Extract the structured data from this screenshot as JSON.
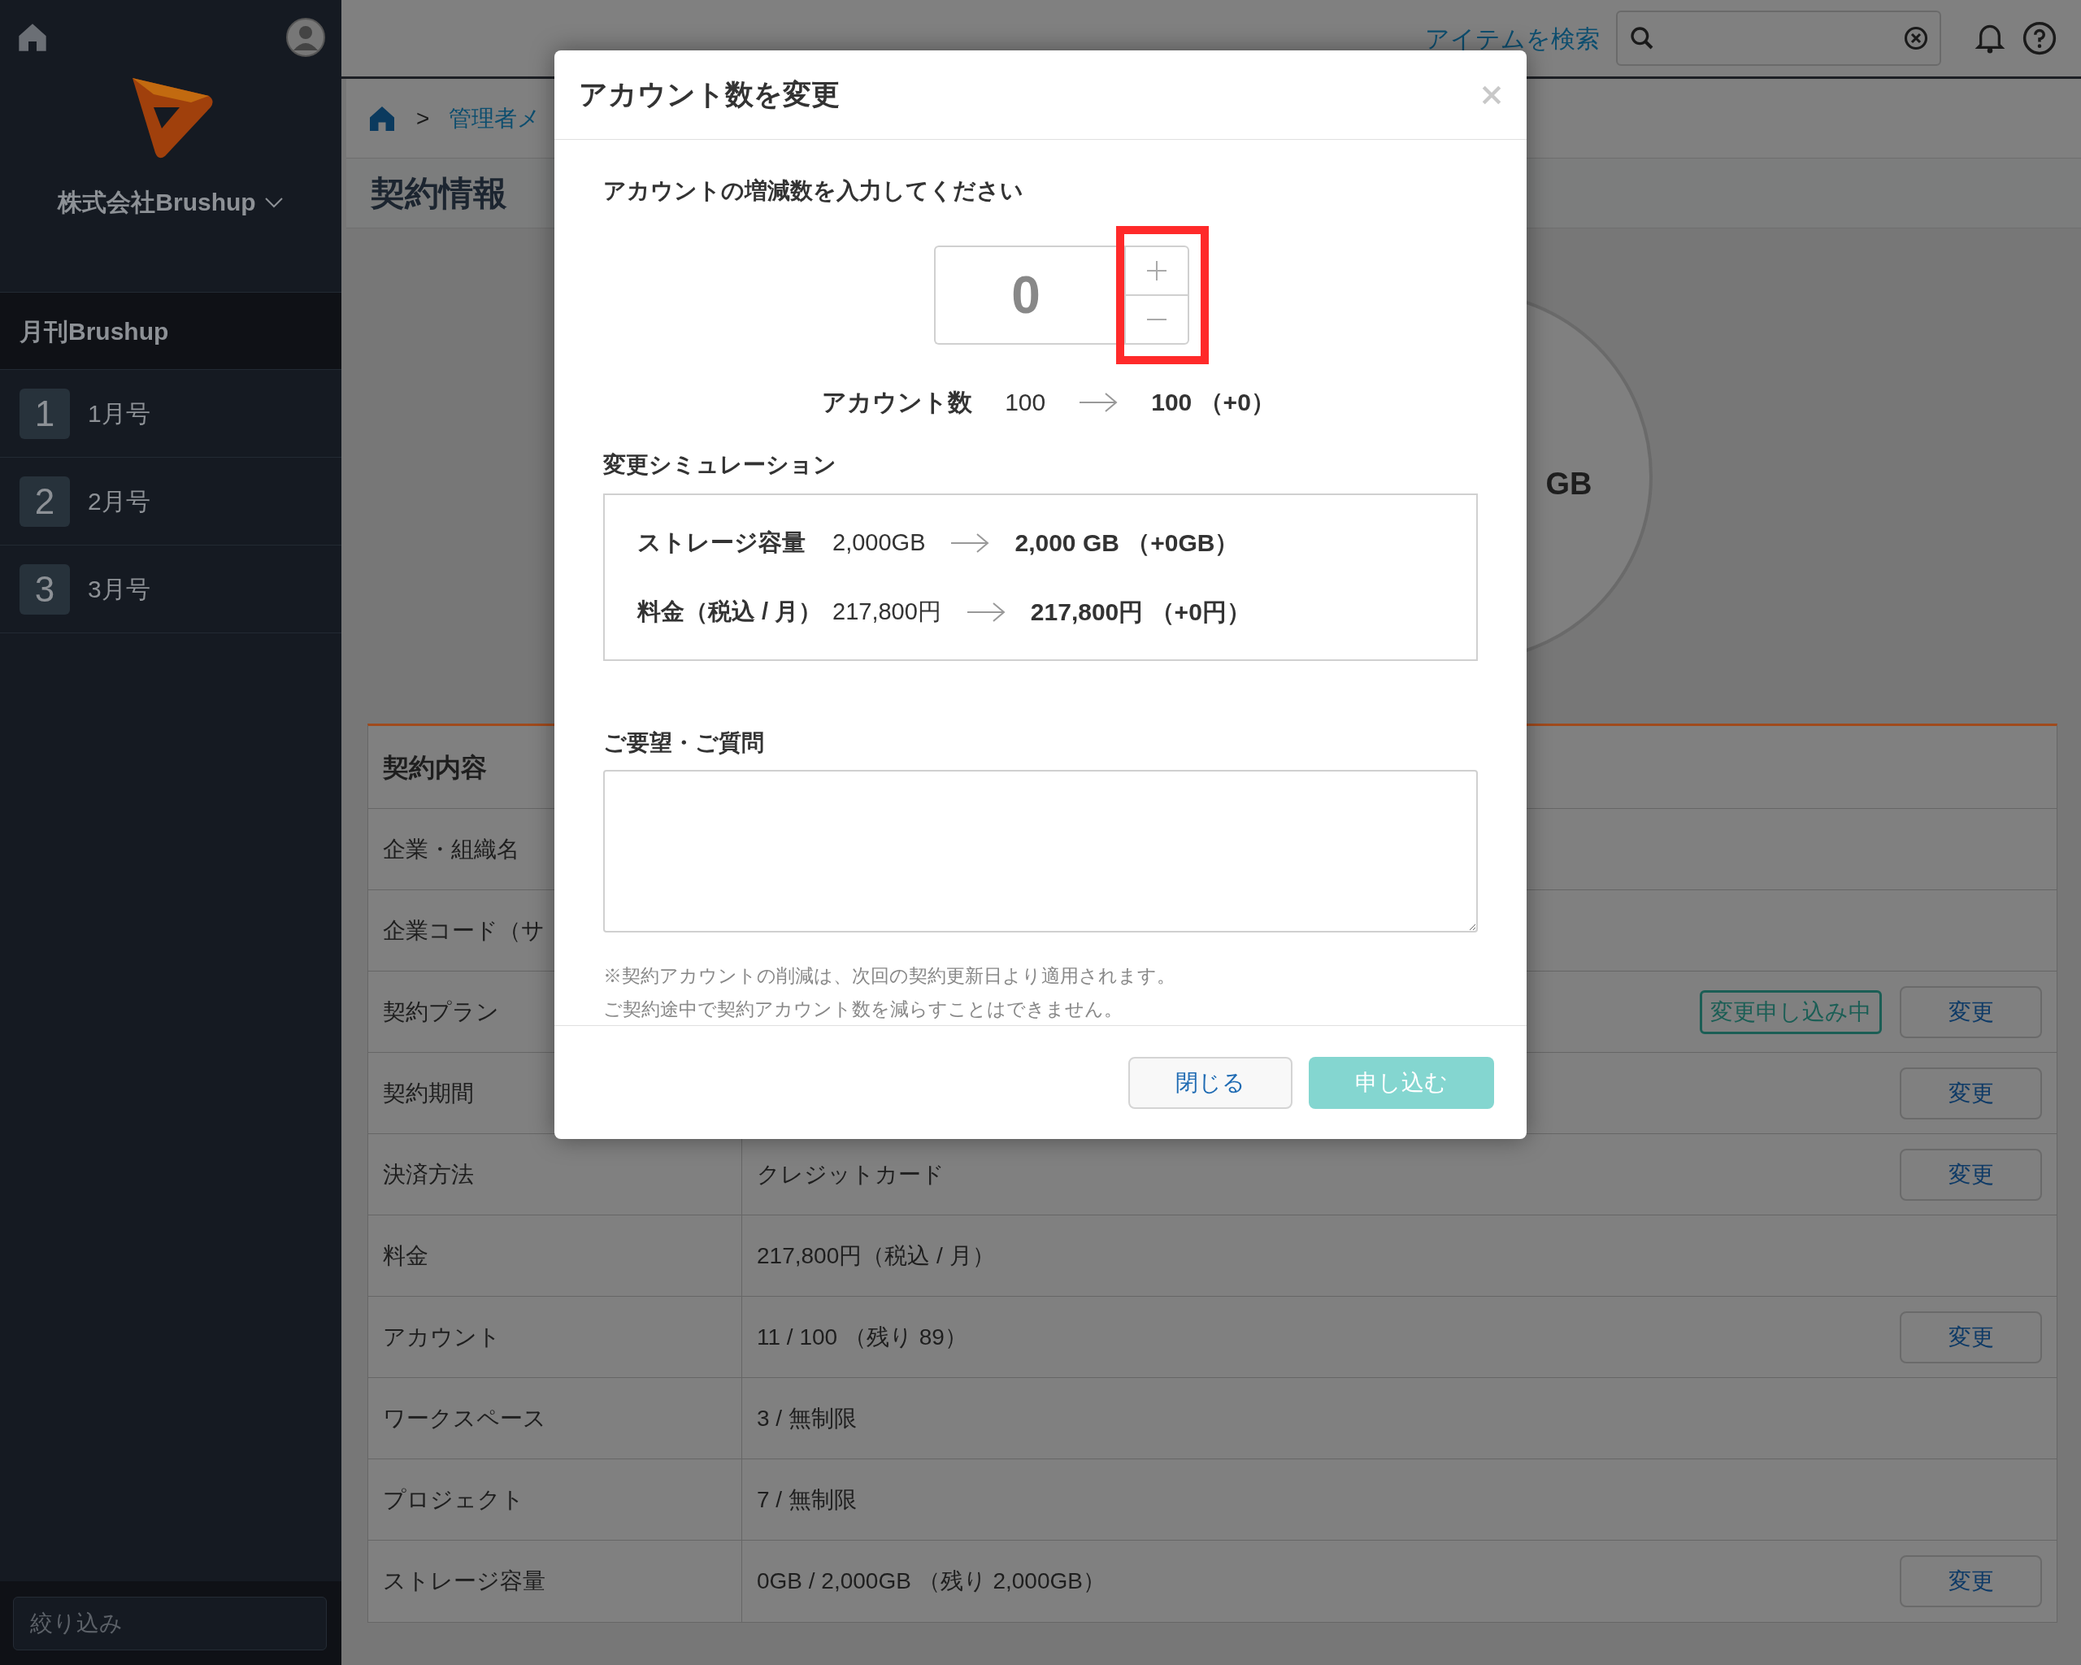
{
  "sidebar": {
    "company": "株式会社Brushup",
    "section": "月刊Brushup",
    "items": [
      {
        "number": "1",
        "label": "1月号"
      },
      {
        "number": "2",
        "label": "2月号"
      },
      {
        "number": "3",
        "label": "3月号"
      }
    ],
    "filter": {
      "placeholder": "絞り込み"
    }
  },
  "topbar": {
    "search_link": "アイテムを検索"
  },
  "breadcrumb": {
    "separator": ">",
    "items": [
      "管理者メ"
    ]
  },
  "page_title": "契約情報",
  "storage_gauge": {
    "unit": "GB"
  },
  "contract": {
    "title": "契約内容",
    "rows": [
      {
        "label": "企業・組織名"
      },
      {
        "label": "企業コード（サ"
      },
      {
        "label": "契約プラン",
        "badge": "変更申し込み中",
        "button": "変更"
      },
      {
        "label": "契約期間",
        "button": "変更"
      },
      {
        "label": "決済方法",
        "value": "クレジットカード",
        "button": "変更"
      },
      {
        "label": "料金",
        "value": "217,800円（税込 / 月）"
      },
      {
        "label": "アカウント",
        "value": "11 / 100 （残り 89）",
        "button": "変更"
      },
      {
        "label": "ワークスペース",
        "value": "3 / 無制限"
      },
      {
        "label": "プロジェクト",
        "value": "7 / 無制限"
      },
      {
        "label": "ストレージ容量",
        "value": "0GB / 2,000GB （残り 2,000GB）",
        "button": "変更"
      }
    ]
  },
  "dialog": {
    "title": "アカウント数を変更",
    "prompt": "アカウントの増減数を入力してください",
    "stepper": {
      "value": "0",
      "highlighted": true
    },
    "account_summary": {
      "label": "アカウント数",
      "from": "100",
      "to": "100 （+0）"
    },
    "simulation": {
      "title": "変更シミュレーション",
      "rows": [
        {
          "label": "ストレージ容量",
          "from": "2,000GB",
          "to": "2,000 GB （+0GB）"
        },
        {
          "label": "料金（税込 / 月）",
          "from": "217,800円",
          "to": "217,800円 （+0円）"
        }
      ]
    },
    "request_label": "ご要望・ご質問",
    "notes": [
      "※契約アカウントの削減は、次回の契約更新日より適用されます。",
      "ご契約途中で契約アカウント数を減らすことはできません。"
    ],
    "buttons": {
      "close": "閉じる",
      "submit": {
        "label": "申し込む",
        "disabled": true
      }
    }
  }
}
